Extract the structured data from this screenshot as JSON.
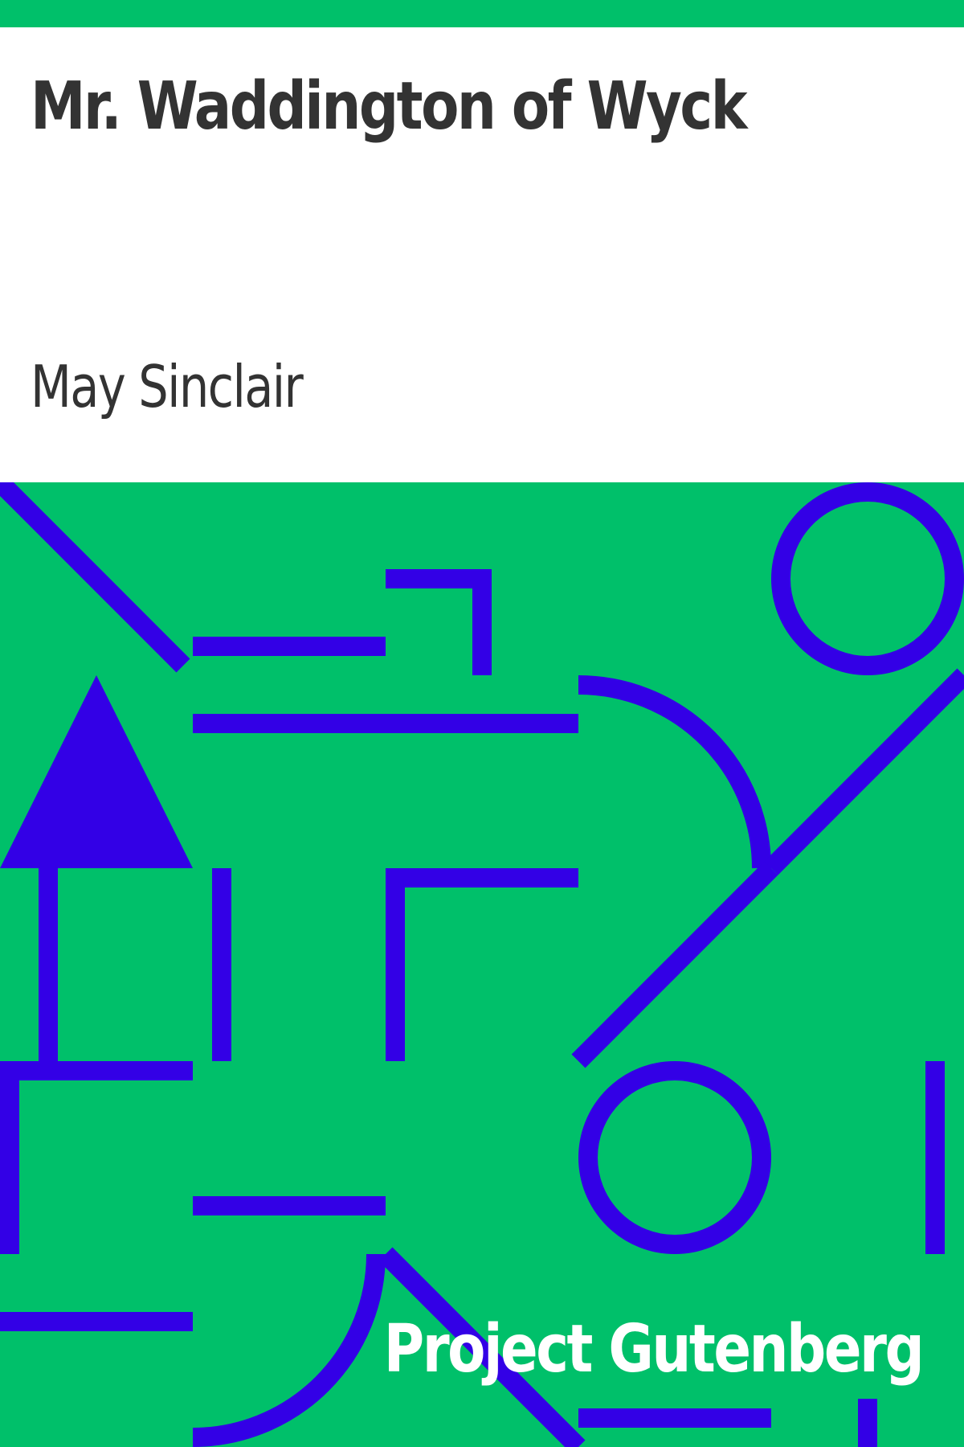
{
  "book": {
    "title": "Mr. Waddington of Wyck",
    "author": "May Sinclair",
    "publisher": "Project Gutenberg"
  },
  "colors": {
    "background": "#ffffff",
    "accent_green": "#00c06a",
    "pattern_blue": "#3300e6",
    "title_text": "#333333",
    "publisher_text": "#ffffff"
  }
}
